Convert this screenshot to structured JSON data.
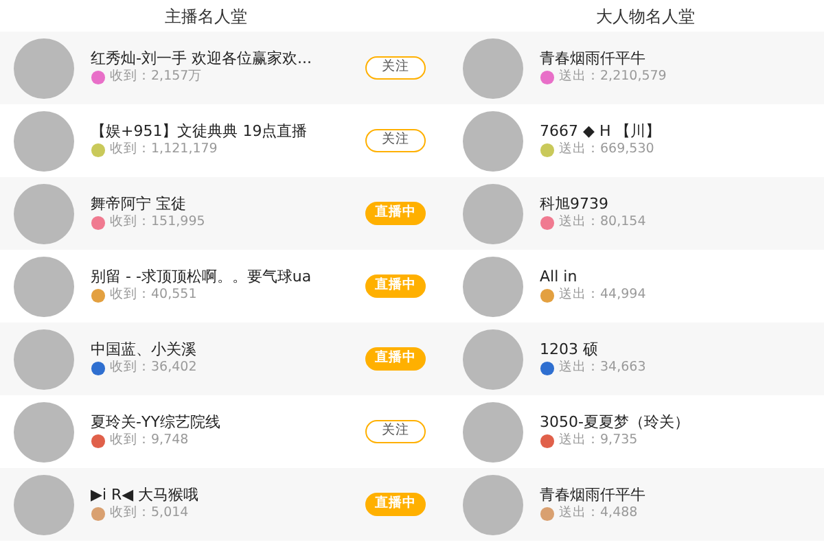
{
  "headers": [
    "主播名人堂",
    "大人物名人堂"
  ],
  "streamers": [
    {
      "name": "红秀灿-刘一手 欢迎各位赢家欢...",
      "stat": "收到：2,157万",
      "color": "#e86fc8",
      "button": {
        "kind": "follow",
        "label": "关注"
      }
    },
    {
      "name": "【娱+951】文徒典典 19点直播",
      "stat": "收到：1,121,179",
      "color": "#c9c95a",
      "button": {
        "kind": "follow",
        "label": "关注"
      }
    },
    {
      "name": "舞帝阿宁 宝徒",
      "stat": "收到：151,995",
      "color": "#f07a90",
      "button": {
        "kind": "live",
        "label": "直播中"
      }
    },
    {
      "name": "别留 - -求顶顶松啊。。要气球ua",
      "stat": "收到：40,551",
      "color": "#e3a040",
      "button": {
        "kind": "live",
        "label": "直播中"
      }
    },
    {
      "name": "中国蓝、小关溪",
      "stat": "收到：36,402",
      "color": "#2f6fd0",
      "button": {
        "kind": "live",
        "label": "直播中"
      }
    },
    {
      "name": "夏玲关-YY综艺院线",
      "stat": "收到：9,748",
      "color": "#e0604a",
      "button": {
        "kind": "follow",
        "label": "关注"
      }
    },
    {
      "name": "▶i R◀ 大马猴哦",
      "stat": "收到：5,014",
      "color": "#d9a070",
      "button": {
        "kind": "live",
        "label": "直播中"
      }
    }
  ],
  "donors": [
    {
      "name": "青春烟雨仟平牛",
      "stat": "送出：2,210,579",
      "color": "#e86fc8"
    },
    {
      "name": "7667 ◆ H 【川】",
      "stat": "送出：669,530",
      "color": "#c9c95a"
    },
    {
      "name": "科旭9739",
      "stat": "送出：80,154",
      "color": "#f07a90"
    },
    {
      "name": "All in",
      "stat": "送出：44,994",
      "color": "#e3a040"
    },
    {
      "name": "1203 硕",
      "stat": "送出：34,663",
      "color": "#2f6fd0"
    },
    {
      "name": "3050-夏夏梦（玲关）",
      "stat": "送出：9,735",
      "color": "#e0604a"
    },
    {
      "name": "青春烟雨仟平牛",
      "stat": "送出：4,488",
      "color": "#d9a070"
    }
  ]
}
